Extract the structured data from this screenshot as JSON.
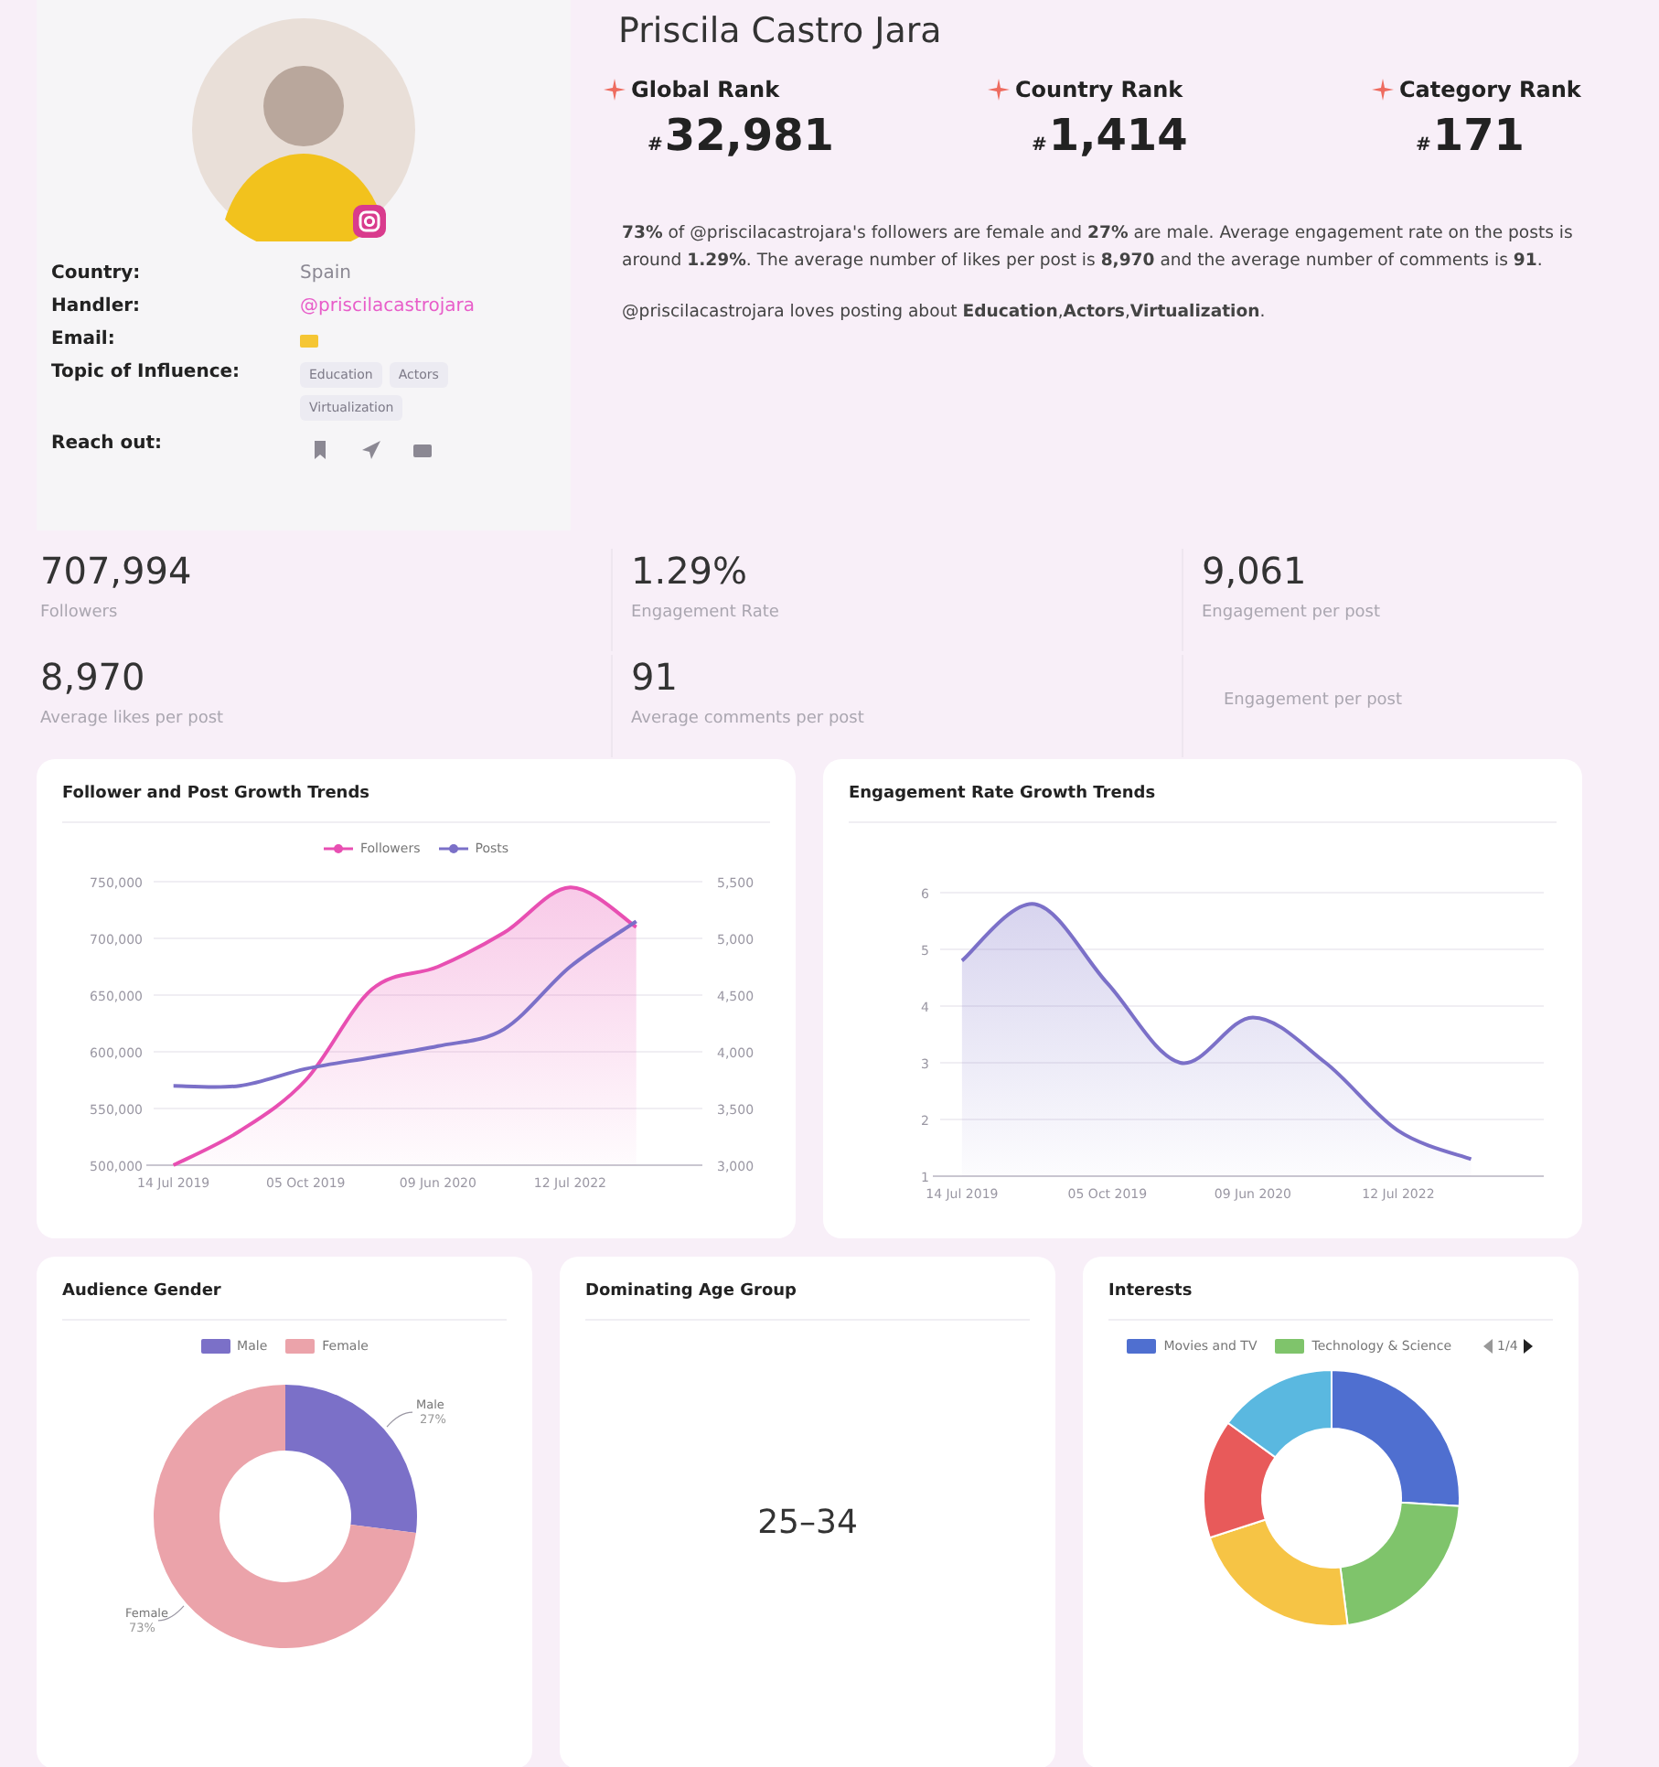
{
  "profile": {
    "name": "Priscila Castro Jara",
    "details": [
      {
        "label": "Country:",
        "kind": "text",
        "value": "Spain"
      },
      {
        "label": "Handler:",
        "kind": "link",
        "value": "@priscilacastrojara"
      },
      {
        "label": "Email:",
        "kind": "mail"
      },
      {
        "label": "Topic of Influence:",
        "kind": "tags",
        "tags": [
          "Education",
          "Actors",
          "Virtualization"
        ]
      },
      {
        "label": "Reach out:",
        "kind": "actions"
      }
    ]
  },
  "ranks": [
    {
      "label": "Global Rank",
      "hash": "#",
      "value": "32,981"
    },
    {
      "label": "Country Rank",
      "hash": "#",
      "value": "1,414"
    },
    {
      "label": "Category Rank",
      "hash": "#",
      "value": "171"
    }
  ],
  "summary": [
    "**73%** of @priscilacastrojara's followers are female and **27%** are male. Average engagement rate on the posts is around **1.29%**. The average number of likes per post is **8,970** and the average number of comments is **91**.",
    "@priscilacastrojara loves posting about **Education**,**Actors**,**Virtualization**."
  ],
  "stats": [
    {
      "value": "707,994",
      "label": "Followers"
    },
    {
      "value": "1.29%",
      "label": "Engagement Rate"
    },
    {
      "value": "9,061",
      "label": "Engagement per post"
    },
    {
      "value": "8,970",
      "label": "Average likes per post"
    },
    {
      "value": "91",
      "label": "Average comments per post"
    },
    {
      "label": "Engagement per post"
    }
  ],
  "charts": [
    {
      "chart_data": {
        "type": "area",
        "title": "Follower and Post Growth Trends",
        "categories": [
          "14 Jul 2019",
          null,
          "05 Oct 2019",
          null,
          "09 Jun 2020",
          null,
          "12 Jul 2022",
          null
        ],
        "ylim": [
          500000,
          750000
        ],
        "yticks": [
          {
            "value": 500000,
            "label": "500,000"
          },
          {
            "value": 550000,
            "label": "550,000"
          },
          {
            "value": 600000,
            "label": "600,000"
          },
          {
            "value": 650000,
            "label": "650,000"
          },
          {
            "value": 700000,
            "label": "700,000"
          },
          {
            "value": 750000,
            "label": "750,000"
          }
        ],
        "y2lim": [
          3000,
          5500
        ],
        "y2ticks": [
          {
            "value": 3000,
            "label": "3,000"
          },
          {
            "value": 3500,
            "label": "3,500"
          },
          {
            "value": 4000,
            "label": "4,000"
          },
          {
            "value": 4500,
            "label": "4,500"
          },
          {
            "value": 5000,
            "label": "5,000"
          },
          {
            "value": 5500,
            "label": "5,500"
          }
        ],
        "grid": true,
        "series": [
          {
            "name": "Followers",
            "color": "#e84fb2",
            "values": [
              500000,
              530000,
              575000,
              655000,
              675000,
              705000,
              745000,
              710000
            ]
          },
          {
            "name": "Posts",
            "type": "line",
            "color": "#7b70c8",
            "axis": "y2",
            "values": [
              3700,
              3700,
              3850,
              3950,
              4050,
              4200,
              4750,
              5150
            ]
          }
        ]
      }
    },
    {
      "chart_data": {
        "type": "area",
        "title": "Engagement Rate Growth Trends",
        "categories": [
          "14 Jul 2019",
          null,
          "05 Oct 2019",
          null,
          "09 Jun 2020",
          null,
          "12 Jul 2022",
          null
        ],
        "ylim": [
          1,
          6
        ],
        "yticks": [
          1,
          2,
          3,
          4,
          5,
          6
        ],
        "grid": true,
        "series": [
          {
            "color": "#7b70c8",
            "values": [
              4.8,
              5.8,
              4.4,
              3.0,
              3.8,
              3.0,
              1.8,
              1.3
            ]
          }
        ]
      }
    }
  ],
  "gender": {
    "chart_data": {
      "type": "donut",
      "title": "Audience Gender",
      "categories": [
        "Male",
        "Female"
      ],
      "values": [
        27,
        73
      ],
      "value_labels": [
        "27%",
        "73%"
      ]
    },
    "legend": [
      {
        "label": "Male",
        "color": "#7b70c8"
      },
      {
        "label": "Female",
        "color": "#eba3aa"
      }
    ]
  },
  "age": {
    "title": "Dominating Age Group",
    "value": "25–34"
  },
  "interests": {
    "title": "Interests",
    "legend": [
      {
        "label": "Movies and TV",
        "color": "#4f6fd0"
      },
      {
        "label": "Technology & Science",
        "color": "#7fc46b"
      }
    ],
    "page": "1/4"
  }
}
